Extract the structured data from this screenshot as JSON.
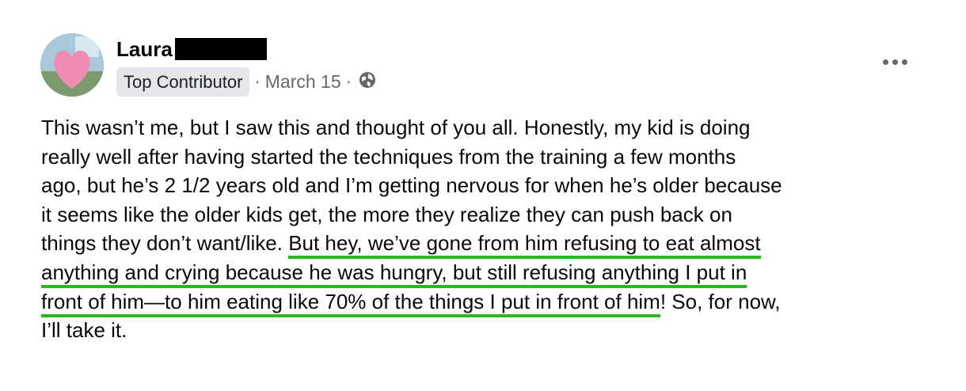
{
  "post": {
    "author_name": "Laura",
    "badge": "Top Contributor",
    "separator": "·",
    "date": "March 15",
    "audience_icon": "globe-icon",
    "more_icon": "more-options-icon",
    "body_lines": [
      "This wasn’t me, but I saw this and thought of you all. Honestly, my kid is doing",
      "really well after having started the techniques from the training a few months",
      "ago, but he’s 2 1/2 years old and I’m getting nervous for when he’s older because",
      "it seems like the older kids get, the more they realize they can push back on",
      "things they don’t want/like. ",
      "But hey, we’ve gone from him refusing to eat almost",
      "anything and crying because he was hungry, but still refusing anything I put in",
      "front of him—to him eating like 70% of the things I put in front of him",
      "! So, for now,",
      "I’ll take it."
    ]
  },
  "colors": {
    "highlight_underline": "#2bb71f",
    "badge_background": "#e4e6eb",
    "meta_text": "#65676b",
    "redaction": "#000000"
  }
}
